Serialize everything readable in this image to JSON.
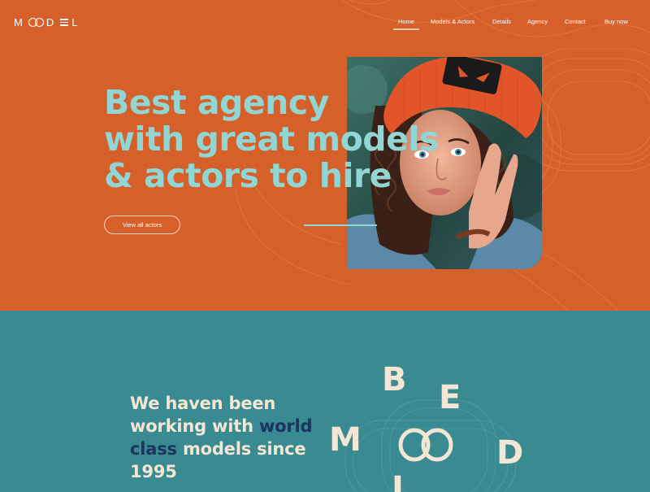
{
  "brand": {
    "logo_text_left": "M",
    "logo_text_right": "D",
    "logo_text_end": "L",
    "logo_alt": "MOODEL"
  },
  "nav": {
    "items": [
      "Home",
      "Models & Actors",
      "Details",
      "Agency",
      "Contact",
      "Buy now"
    ],
    "active": "Home"
  },
  "hero": {
    "headline_lines": [
      "Best agency",
      "with great models",
      "& actors to hire"
    ],
    "cta_label": "View all actors"
  },
  "about": {
    "text_part1": "We haven been working with ",
    "text_highlight": "world class",
    "text_part2": " models since 1995"
  },
  "floating_letters": [
    "B",
    "E",
    "M",
    "D",
    "L"
  ],
  "colors": {
    "hero_bg": "#d6602a",
    "accent_teal": "#8fd6d4",
    "section_bg": "#3a8a91",
    "cream": "#f3e6d4",
    "navy": "#1d3461",
    "hat": "#e2552a"
  },
  "icons": {
    "logo": "moodel-logo-icon"
  }
}
